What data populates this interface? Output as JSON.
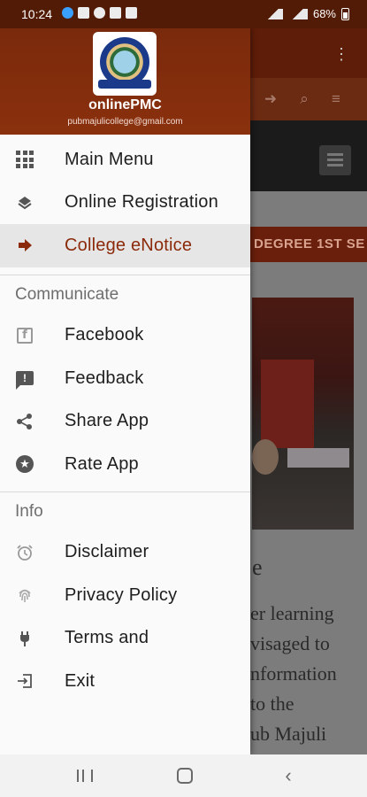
{
  "status_bar": {
    "time": "10:24",
    "battery": "68%"
  },
  "background": {
    "ticker_text": "DEGREE 1ST SE",
    "heading_fragment": "e",
    "text_lines": [
      "er  learning",
      "visaged  to",
      "nformation",
      "to      the",
      "ub    Majuli"
    ]
  },
  "drawer": {
    "app_name": "onlinePMC",
    "email": "pubmajulicollege@gmail.com",
    "main_items": [
      {
        "label": "Main Menu",
        "icon": "grid-icon"
      },
      {
        "label": "Online Registration",
        "icon": "layers-icon"
      },
      {
        "label": "College eNotice",
        "icon": "arrow-right-icon",
        "active": true
      }
    ],
    "communicate": {
      "title": "Communicate",
      "items": [
        {
          "label": "Facebook",
          "icon": "facebook-icon"
        },
        {
          "label": "Feedback",
          "icon": "feedback-icon"
        },
        {
          "label": "Share App",
          "icon": "share-icon"
        },
        {
          "label": "Rate App",
          "icon": "star-icon"
        }
      ]
    },
    "info": {
      "title": "Info",
      "items": [
        {
          "label": "Disclaimer",
          "icon": "alarm-icon"
        },
        {
          "label": "Privacy Policy",
          "icon": "fingerprint-icon"
        },
        {
          "label": "Terms and",
          "icon": "plug-icon"
        },
        {
          "label": "Exit",
          "icon": "exit-icon"
        }
      ]
    }
  },
  "colors": {
    "header": "#7a2a0c",
    "active_text": "#8b2a0a",
    "active_bg": "#e6e6e6"
  }
}
